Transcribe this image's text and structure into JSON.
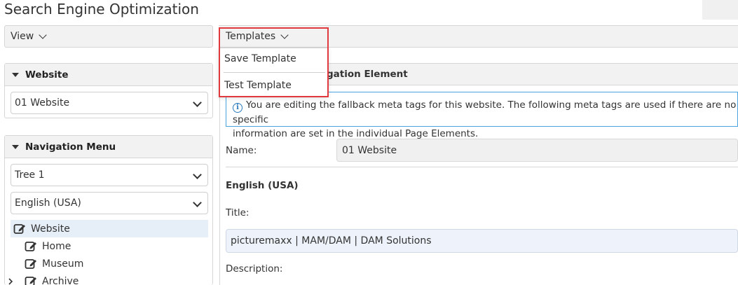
{
  "page": {
    "title": "Search Engine Optimization"
  },
  "toolbar": {
    "view_label": "View",
    "templates_label": "Templates"
  },
  "templates_menu": {
    "items": [
      "Save Template",
      "Test Template"
    ]
  },
  "website_panel": {
    "title": "Website",
    "selected": "01 Website"
  },
  "nav_panel": {
    "title": "Navigation Menu",
    "tree_select": "Tree 1",
    "language_select": "English (USA)",
    "tree": [
      {
        "label": "Website",
        "selected": true
      },
      {
        "label": "Home"
      },
      {
        "label": "Museum"
      },
      {
        "label": "Archive",
        "collapsed": true
      }
    ]
  },
  "main": {
    "panel_title": "gation Element",
    "info_line1": "You are editing the fallback meta tags for this website. The following meta tags are used if there are no specific",
    "info_line2": "information are set in the individual Page Elements.",
    "name_label": "Name:",
    "name_value": "01 Website",
    "language_section": "English (USA)",
    "title_label": "Title:",
    "title_value": "picturemaxx | MAM/DAM | DAM Solutions",
    "description_label": "Description:"
  },
  "colors": {
    "highlight": "#e0393e",
    "info_border": "#4aa3df",
    "selected_row": "#e6eef7"
  }
}
